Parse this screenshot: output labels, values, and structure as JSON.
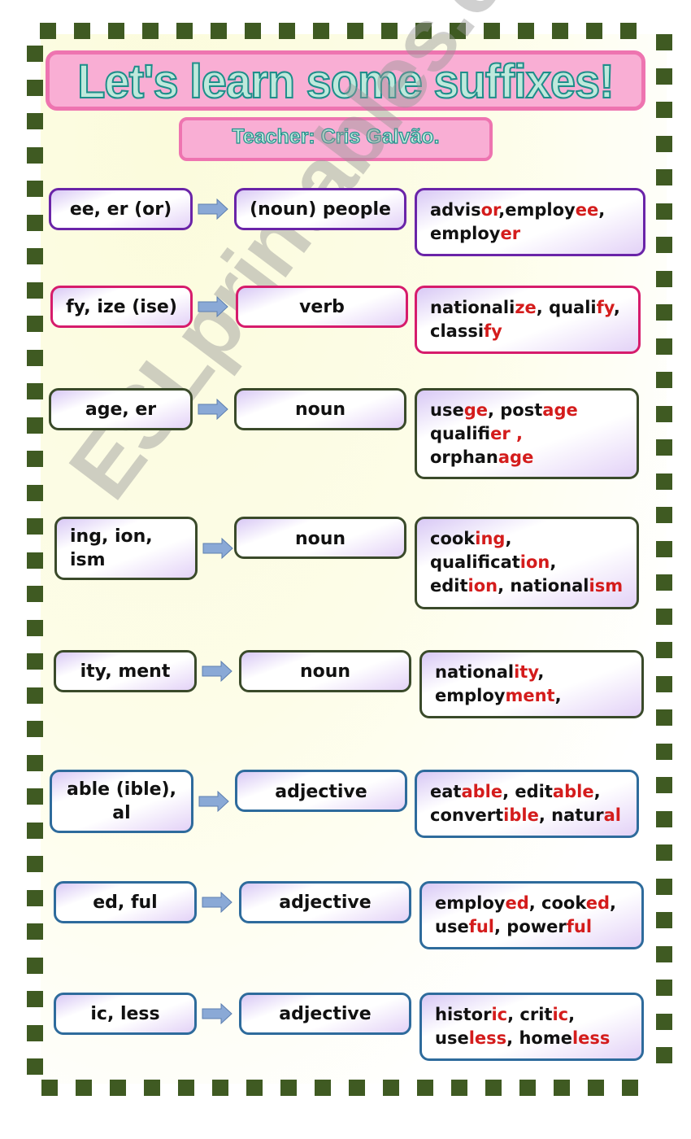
{
  "title": "Let's learn some suffixes!",
  "teacher": "Teacher: Cris Galvão.",
  "watermark": "ESLprintables.com",
  "colors": {
    "border_squares": "#3f5a22",
    "title_bg": "#f9aed4",
    "title_border": "#ee74b0",
    "title_text": "#1e8e8a",
    "suffix_highlight": "#d41c1c",
    "arrow": "#8aa9d6"
  },
  "rows": [
    {
      "suffixes": "ee, er (or)",
      "category": "(noun) people",
      "examples": [
        [
          {
            "t": "advis"
          },
          {
            "t": "or",
            "hl": true
          },
          {
            "t": ",employ"
          },
          {
            "t": "ee",
            "hl": true
          },
          {
            "t": ","
          }
        ],
        [
          {
            "t": "employ"
          },
          {
            "t": "er",
            "hl": true
          }
        ]
      ]
    },
    {
      "suffixes": "fy, ize (ise)",
      "category": "verb",
      "examples": [
        [
          {
            "t": "nationali"
          },
          {
            "t": "ze",
            "hl": true
          },
          {
            "t": ", quali"
          },
          {
            "t": "fy",
            "hl": true
          },
          {
            "t": ","
          }
        ],
        [
          {
            "t": "classi"
          },
          {
            "t": "fy",
            "hl": true
          }
        ]
      ]
    },
    {
      "suffixes": "age, er",
      "category": "noun",
      "examples": [
        [
          {
            "t": "use"
          },
          {
            "t": "ge",
            "hl": true
          },
          {
            "t": ", post"
          },
          {
            "t": "age",
            "hl": true
          }
        ],
        [
          {
            "t": "qualifi"
          },
          {
            "t": "er ,",
            "hl": true
          }
        ],
        [
          {
            "t": "orphan"
          },
          {
            "t": "age",
            "hl": true
          }
        ]
      ]
    },
    {
      "suffixes": "ing, ion, ism",
      "suffixes_lines": [
        "ing, ion,",
        "ism"
      ],
      "category": "noun",
      "examples": [
        [
          {
            "t": "cook"
          },
          {
            "t": "ing",
            "hl": true
          },
          {
            "t": ","
          }
        ],
        [
          {
            "t": "qualificat"
          },
          {
            "t": "ion",
            "hl": true
          },
          {
            "t": ","
          }
        ],
        [
          {
            "t": "edit"
          },
          {
            "t": "ion",
            "hl": true
          },
          {
            "t": ", national"
          },
          {
            "t": "ism",
            "hl": true
          }
        ]
      ]
    },
    {
      "suffixes": "ity, ment",
      "category": "noun",
      "examples": [
        [
          {
            "t": "national"
          },
          {
            "t": "ity",
            "hl": true
          },
          {
            "t": ","
          }
        ],
        [
          {
            "t": "employ"
          },
          {
            "t": "ment",
            "hl": true
          },
          {
            "t": ","
          }
        ]
      ]
    },
    {
      "suffixes": "able (ible), al",
      "suffixes_lines": [
        "able (ible),",
        "al"
      ],
      "category": "adjective",
      "examples": [
        [
          {
            "t": "eat"
          },
          {
            "t": "able",
            "hl": true
          },
          {
            "t": ", edit"
          },
          {
            "t": "able",
            "hl": true
          },
          {
            "t": ","
          }
        ],
        [
          {
            "t": "convert"
          },
          {
            "t": "ible",
            "hl": true
          },
          {
            "t": ", natur"
          },
          {
            "t": "al",
            "hl": true
          }
        ]
      ]
    },
    {
      "suffixes": "ed, ful",
      "category": "adjective",
      "examples": [
        [
          {
            "t": "employ"
          },
          {
            "t": "ed",
            "hl": true
          },
          {
            "t": ", cook"
          },
          {
            "t": "ed",
            "hl": true
          },
          {
            "t": ","
          }
        ],
        [
          {
            "t": "use"
          },
          {
            "t": "ful",
            "hl": true
          },
          {
            "t": ", power"
          },
          {
            "t": "ful",
            "hl": true
          }
        ]
      ]
    },
    {
      "suffixes": "ic, less",
      "category": "adjective",
      "examples": [
        [
          {
            "t": "histor"
          },
          {
            "t": "ic",
            "hl": true
          },
          {
            "t": ", crit"
          },
          {
            "t": "ic",
            "hl": true
          },
          {
            "t": ","
          }
        ],
        [
          {
            "t": "use"
          },
          {
            "t": "less",
            "hl": true
          },
          {
            "t": ", home"
          },
          {
            "t": "less",
            "hl": true
          }
        ]
      ]
    }
  ]
}
